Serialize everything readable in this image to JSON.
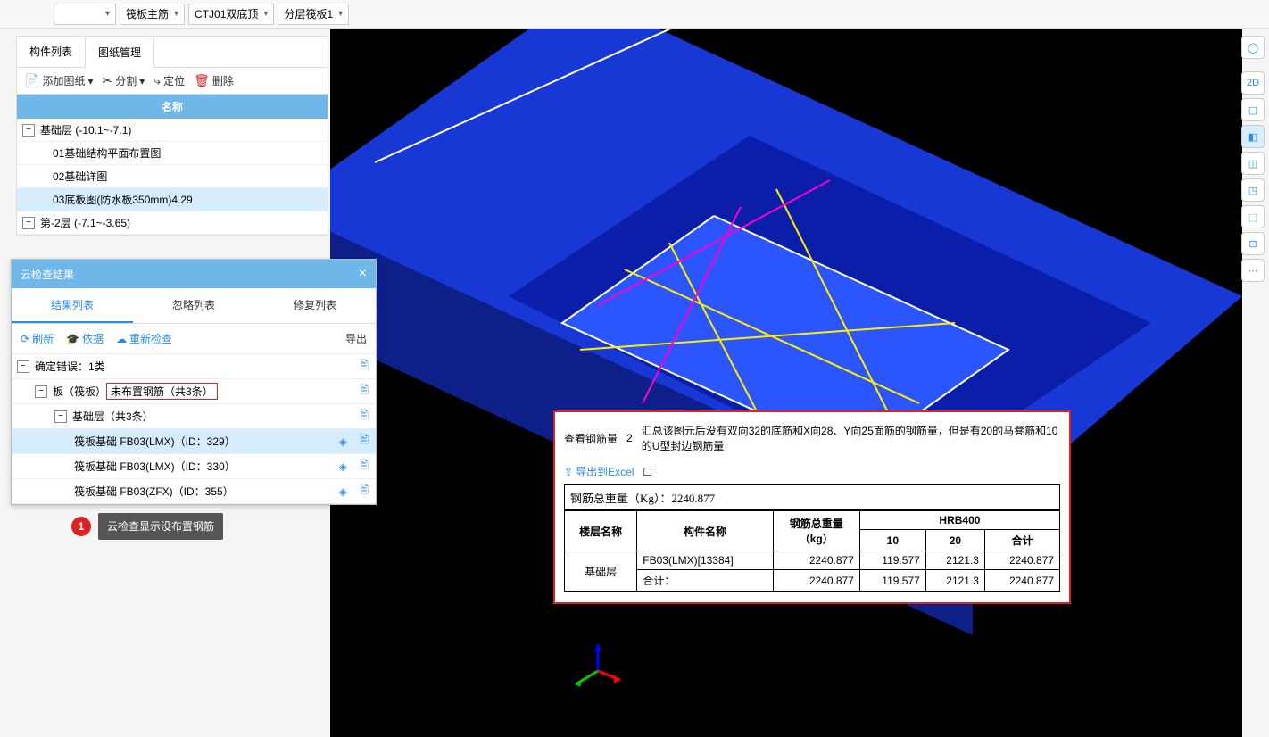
{
  "top": {
    "combos": [
      "",
      "筏板主筋",
      "CTJ01双底顶",
      "分层筏板1"
    ]
  },
  "leftPanel": {
    "tabs": [
      "构件列表",
      "图纸管理"
    ],
    "toolbar": {
      "add": "添加图纸",
      "split": "分割",
      "locate": "定位",
      "delete": "删除"
    },
    "colHead": "名称",
    "tree": {
      "g1": {
        "label": "基础层 (-10.1~-7.1)"
      },
      "g1c": [
        "01基础结构平面布置图",
        "02基础详图",
        "03底板图(防水板350mm)4.29"
      ],
      "g2": {
        "label": "第-2层 (-7.1~-3.65)"
      }
    }
  },
  "cloud": {
    "title": "云检查结果",
    "tabs": [
      "结果列表",
      "忽略列表",
      "修复列表"
    ],
    "tb": {
      "refresh": "刷新",
      "basis": "依据",
      "recheck": "重新检查",
      "export": "导出"
    },
    "rows": {
      "r0": "确定错误：1类",
      "r1a": "板（筏板）",
      "r1b": "未布置钢筋（共3条）",
      "r2": "基础层（共3条）",
      "r3": "筏板基础 FB03(LMX)（ID：329）",
      "r4": "筏板基础 FB03(LMX)（ID：330）",
      "r5": "筏板基础 FB03(ZFX)（ID：355）"
    }
  },
  "annot": {
    "a1": "云检查显示没布置钢筋",
    "a2": "汇总该图元后没有双向32的底筋和X向28、Y向25面筋的钢筋量，但是有20的马凳筋和10的U型封边钢筋量"
  },
  "steel": {
    "title": "查看钢筋量",
    "export": "导出到Excel",
    "totalLabel": "钢筋总重量（Kg）：2240.877",
    "headers": {
      "floor": "楼层名称",
      "comp": "构件名称",
      "wt": "钢筋总重量\n（kg）",
      "group": "HRB400",
      "c10": "10",
      "c20": "20",
      "sum": "合计"
    },
    "rows": [
      {
        "floor": "基础层",
        "comp": "FB03(LMX)[13384]",
        "wt": "2240.877",
        "c10": "119.577",
        "c20": "2121.3",
        "sum": "2240.877"
      },
      {
        "floor": "",
        "comp": "合计：",
        "wt": "2240.877",
        "c10": "119.577",
        "c20": "2121.3",
        "sum": "2240.877"
      }
    ]
  },
  "rightTools": [
    "◯",
    "2D",
    "▢",
    "◧",
    "◫",
    "◳",
    "⬚",
    "⊡",
    "⋯"
  ]
}
